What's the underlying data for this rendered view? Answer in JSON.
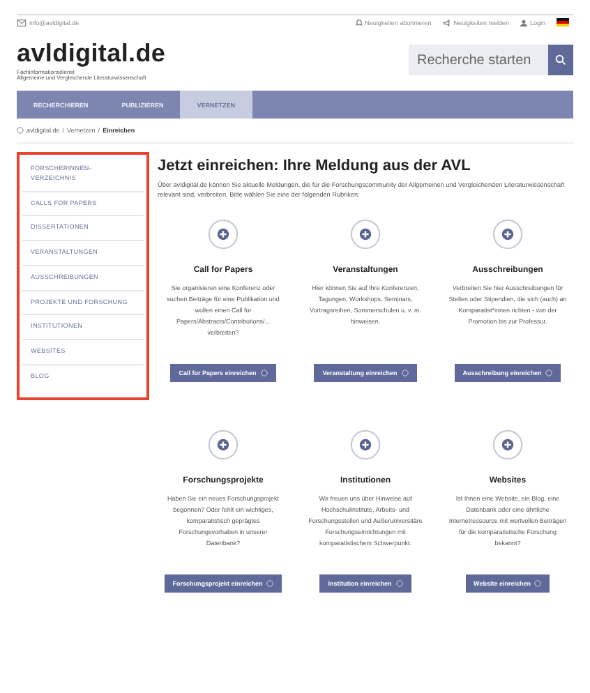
{
  "top_bar": {
    "email": "info@avldigital.de",
    "links": [
      {
        "label": "Neuigkeiten abonnieren",
        "kind": "bell"
      },
      {
        "label": "Neuigkeiten melden",
        "kind": "megaphone"
      },
      {
        "label": "Login",
        "kind": "user"
      }
    ]
  },
  "header": {
    "logo": "avldigital.de",
    "logo_subtitle": [
      "Fachinformationsdienst",
      "Allgemeine und Vergleichende Literaturwissenschaft"
    ],
    "search": {
      "placeholder": "Recherche starten"
    }
  },
  "tabs": [
    {
      "label": "RECHERCHIEREN",
      "selected": false
    },
    {
      "label": "PUBLIZIEREN",
      "selected": false
    },
    {
      "label": "VERNETZEN",
      "selected": true
    }
  ],
  "breadcrumb_separator": "/",
  "breadcrumb": [
    {
      "label": "avldigital.de",
      "current": false
    },
    {
      "label": "Vernetzen",
      "current": false
    },
    {
      "label": "Einreichen",
      "current": true
    }
  ],
  "sidebar": {
    "items": [
      "FORSCHERINNEN-VERZEICHNIS",
      "CALLS FOR PAPERS",
      "DISSERTATIONEN",
      "VERANSTALTUNGEN",
      "AUSSCHREIBUNGEN",
      "PROJEKTE UND FORSCHUNG",
      "INSTITUTIONEN",
      "WEBSITES",
      "BLOG"
    ]
  },
  "main": {
    "title": "Jetzt einreichen: Ihre Meldung aus der AVL",
    "intro": "Über avldigital.de können Sie aktuelle Meldungen, die für die Forschungscommunity der Allgemeinen und Vergleichenden Literaturwissenschaft relevant sind, verbreiten. Bitte wählen Sie eine der folgenden Rubriken:",
    "cards": [
      {
        "title": "Call for Papers",
        "text": "Sie organisieren eine Konferenz oder suchen Beiträge für eine Publikation und wollen einen Call for Papers/Abstracts/Contributions/... verbreiten?",
        "button": "Call for Papers einreichen"
      },
      {
        "title": "Veranstaltungen",
        "text": "Hier können Sie auf Ihre Konferenzen, Tagungen, Workshops, Seminars, Vortragsreihen, Sommerschulen u. v. m. hinweisen.",
        "button": "Veranstaltung einreichen"
      },
      {
        "title": "Ausschreibungen",
        "text": "Verbreiten Sie hier Ausschreibungen für Stellen oder Stipendien, die sich (auch) an Komparatist*innen richten - von der Promotion bis zur Professur.",
        "button": "Ausschreibung einreichen"
      },
      {
        "title": "Forschungsprojekte",
        "text": "Haben Sie ein neues Forschungsprojekt begonnen? Oder fehlt ein wichtiges, komparatistisch geprägtes Forschungsvorhaben in unserer Datenbank?",
        "button": "Forschungsprojekt einreichen"
      },
      {
        "title": "Institutionen",
        "text": "Wir freuen uns über Hinweise auf Hochschulinstitute, Arbeits- und Forschungsstellen und Außeruniversitäre Forschungseinrichtungen mit komparatistischem Schwerpunkt.",
        "button": "Institution einreichen"
      },
      {
        "title": "Websites",
        "text": "Ist Ihnen eine Website, ein Blog, eine Datenbank oder eine ähnliche Internetressource mit wertvollen Beiträgen für die komparatistische Forschung bekannt?",
        "button": "Website einreichen"
      }
    ]
  }
}
